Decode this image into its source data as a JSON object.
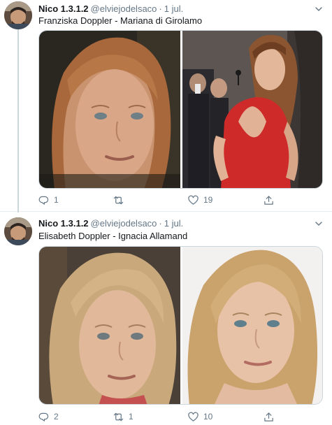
{
  "colors": {
    "text": "#14171a",
    "secondary": "#657786",
    "border": "#e6ecf0",
    "thread_line": "#ccd6dd"
  },
  "tweets": [
    {
      "display_name": "Nico 1.3.1.2",
      "handle": "@elviejodelsaco",
      "separator": "·",
      "date": "1 jul.",
      "text": "Franziska Doppler - Mariana di Girolamo",
      "icons": {
        "reply": "reply-icon",
        "retweet": "retweet-icon",
        "like": "heart-icon",
        "share": "share-icon",
        "menu": "chevron-down-icon"
      },
      "reply_count": "1",
      "retweet_count": "",
      "like_count": "19"
    },
    {
      "display_name": "Nico 1.3.1.2",
      "handle": "@elviejodelsaco",
      "separator": "·",
      "date": "1 jul.",
      "text": "Elisabeth Doppler - Ignacia Allamand",
      "icons": {
        "reply": "reply-icon",
        "retweet": "retweet-icon",
        "like": "heart-icon",
        "share": "share-icon",
        "menu": "chevron-down-icon"
      },
      "reply_count": "2",
      "retweet_count": "1",
      "like_count": "10"
    }
  ]
}
